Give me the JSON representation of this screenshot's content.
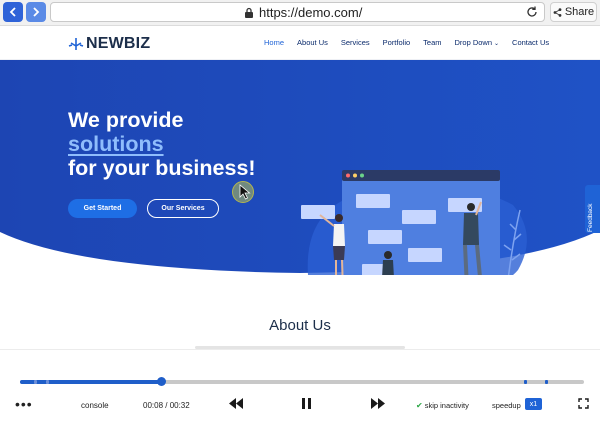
{
  "browser": {
    "back_icon": "chevron-left-icon",
    "forward_icon": "chevron-right-icon",
    "url": "https://demo.com/",
    "share_label": "Share",
    "accent": "#2f63d8"
  },
  "site": {
    "logo_text": "NEWBIZ",
    "nav": [
      {
        "label": "Home",
        "active": true
      },
      {
        "label": "About Us"
      },
      {
        "label": "Services"
      },
      {
        "label": "Portfolio"
      },
      {
        "label": "Team"
      },
      {
        "label": "Drop Down"
      },
      {
        "label": "Contact Us"
      }
    ],
    "hero": {
      "line1": "We provide",
      "line2": "solutions",
      "line3": "for your business!",
      "get_started": "Get Started",
      "our_services": "Our Services",
      "background": "#1e4fc0"
    },
    "feedback_label": "Feedback",
    "about_title": "About Us"
  },
  "player": {
    "progress": 0.25,
    "console_label": "console",
    "time": "00:08 / 00:32",
    "skip_label": "skip inactivity",
    "speed_label": "speedup",
    "speed_value": "x1"
  }
}
